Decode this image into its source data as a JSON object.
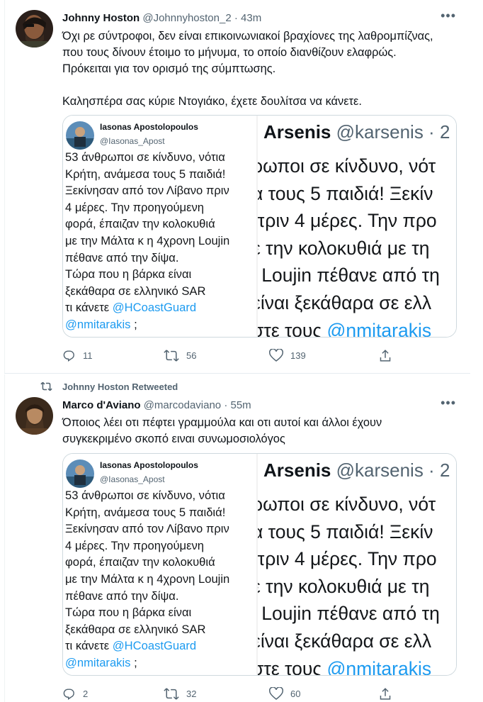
{
  "tweets": [
    {
      "author_name": "Johnny Hoston",
      "author_handle": "@Johnnyhoston_2",
      "sep": "·",
      "time": "43m",
      "text_lines": [
        "Όχι ρε σύντροφοι, δεν είναι επικοινωνιακοί βραχίονες της λαθρομπίζνας,",
        "που τους δίνουν έτοιμο το μήνυμα, το οποίο διανθίζουν ελαφρώς.",
        "Πρόκειται για τον ορισμό της σύμπτωσης.",
        "",
        "Καλησπέρα σας κύριε Ντογιάκο, έχετε δουλίτσα να κάνετε."
      ],
      "quote": {
        "name": "Iasonas Apostolopoulos",
        "handle": "@Iasonas_Apost",
        "body_lines": [
          "53 άνθρωποι σε κίνδυνο, νότια",
          "Κρήτη, ανάμεσα τους 5 παιδιά!",
          "Ξεκίνησαν από τον Λίβανο πριν",
          "4 μέρες. Την προηγούμενη",
          "φορά, έπαιζαν την κολοκυθιά",
          "με την Μάλτα κ η 4χρονη Loujin",
          "πέθανε από την δίψα.",
          "Τώρα που η βάρκα είναι",
          "ξεκάθαρα σε ελληνικό SAR",
          "τι κάνετε "
        ],
        "mention_1": "@HCoastGuard",
        "mention_2": "@nmitarakis",
        "tail": " ;",
        "right_name": "Arsenis",
        "right_handle": "@karsenis · 2",
        "right_lines": [
          "ρωποι σε κίνδυνο, νότ",
          "α τους 5 παιδιά! Ξεκίν",
          "  πριν 4 μέρες. Την προ",
          "ε την κολοκυθιά με τη",
          "ι Loujin πέθανε από τη",
          "είναι ξεκάθαρα σε ελλ",
          "στε τους "
        ],
        "right_mention": "@nmitarakis"
      },
      "actions": {
        "reply": "11",
        "retweet": "56",
        "like": "139"
      }
    },
    {
      "retweet_label": "Johnny Hoston Retweeted",
      "author_name": "Marco d'Aviano",
      "author_handle": "@marcodaviano",
      "sep": "·",
      "time": "55m",
      "text_lines": [
        "Όποιος λέει οτι πέφτει γραμμούλα και οτι αυτοί και άλλοι έχουν",
        "συγκεκριμένο σκοπό ειναι συνωμοσιολόγος"
      ],
      "quote": {
        "name": "Iasonas Apostolopoulos",
        "handle": "@Iasonas_Apost",
        "body_lines": [
          "53 άνθρωποι σε κίνδυνο, νότια",
          "Κρήτη, ανάμεσα τους 5 παιδιά!",
          "Ξεκίνησαν από τον Λίβανο πριν",
          "4 μέρες. Την προηγούμενη",
          "φορά, έπαιζαν την κολοκυθιά",
          "με την Μάλτα κ η 4χρονη Loujin",
          "πέθανε από την δίψα.",
          "Τώρα που η βάρκα είναι",
          "ξεκάθαρα σε ελληνικό SAR",
          "τι κάνετε "
        ],
        "mention_1": "@HCoastGuard",
        "mention_2": "@nmitarakis",
        "tail": " ;",
        "right_name": "Arsenis",
        "right_handle": "@karsenis · 2",
        "right_lines": [
          "ρωποι σε κίνδυνο, νότ",
          "α τους 5 παιδιά! Ξεκίν",
          "  πριν 4 μέρες. Την προ",
          "ε την κολοκυθιά με τη",
          "ι Loujin πέθανε από τη",
          "είναι ξεκάθαρα σε ελλ",
          "στε τους "
        ],
        "right_mention": "@nmitarakis"
      },
      "actions": {
        "reply": "2",
        "retweet": "32",
        "like": "60"
      }
    }
  ],
  "colors": {
    "accent": "#1d9bf0",
    "text": "#0f1419",
    "muted": "#536471",
    "border": "#cfd9de"
  },
  "icons": {
    "more": "more-horizontal-icon",
    "reply": "reply-icon",
    "retweet": "retweet-icon",
    "like": "heart-icon",
    "share": "share-icon"
  }
}
